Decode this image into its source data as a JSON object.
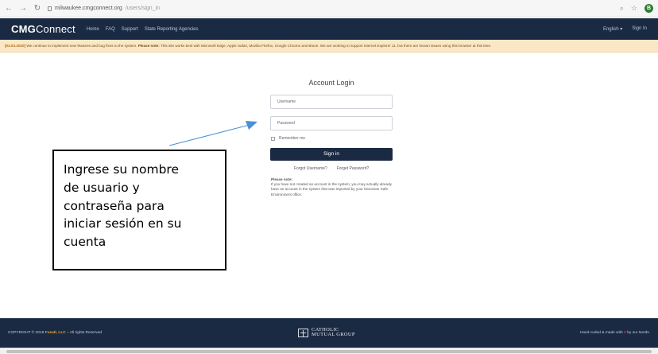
{
  "browser": {
    "url_host": "milwaukee.cmgconnect.org",
    "url_path": "/users/sign_in",
    "back_icon": "arrow-left-icon",
    "forward_icon": "arrow-right-icon",
    "reload_icon": "reload-icon",
    "profile_initial": "B"
  },
  "header": {
    "brand_bold": "CMG",
    "brand_rest": "Connect",
    "nav": [
      "Home",
      "FAQ",
      "Support",
      "State Reporting Agencies"
    ],
    "language": "English ▾",
    "signin": "Sign In"
  },
  "notice": {
    "date": "[02.03.2020]",
    "text1": " We continue to implement new features and bug fixes to the system. ",
    "bold": "Please note:",
    "text2": " This site works best with Microsoft Edge, Apple Safari, Mozilla Firefox, Google Chrome and Brave. We are working to support Internet Explorer 11, but there are known issues using this browser at this time."
  },
  "login": {
    "title": "Account Login",
    "username_placeholder": "Username",
    "password_placeholder": "Password",
    "remember": "Remember me",
    "signin_button": "Sign in",
    "forgot_username": "Forgot Username?",
    "forgot_password": "Forget Password?",
    "note_title": "Please note:",
    "note_text": "If you have not created an account in the system, you may actually already have an account in the system that was imported by your Diocesan Safe Environment office."
  },
  "callout": {
    "lines": [
      "Ingrese su nombre",
      "de usuario y",
      "contraseña para",
      "iniciar sesión en su",
      "cuenta"
    ]
  },
  "footer": {
    "copyright": "COPYRIGHT © 2019 ",
    "company": "Fusati, LLC",
    "rights": " – All rights Reserved",
    "logo_line1": "CATHOLIC",
    "logo_line2": "MUTUAL GROUP",
    "made_prefix": "Hand-coded & made with ",
    "heart": "♥",
    "made_suffix": " by our Nerds."
  },
  "colors": {
    "navy": "#1b2a43",
    "notice_bg": "#fbe7c6",
    "arrow": "#4a90d9"
  }
}
